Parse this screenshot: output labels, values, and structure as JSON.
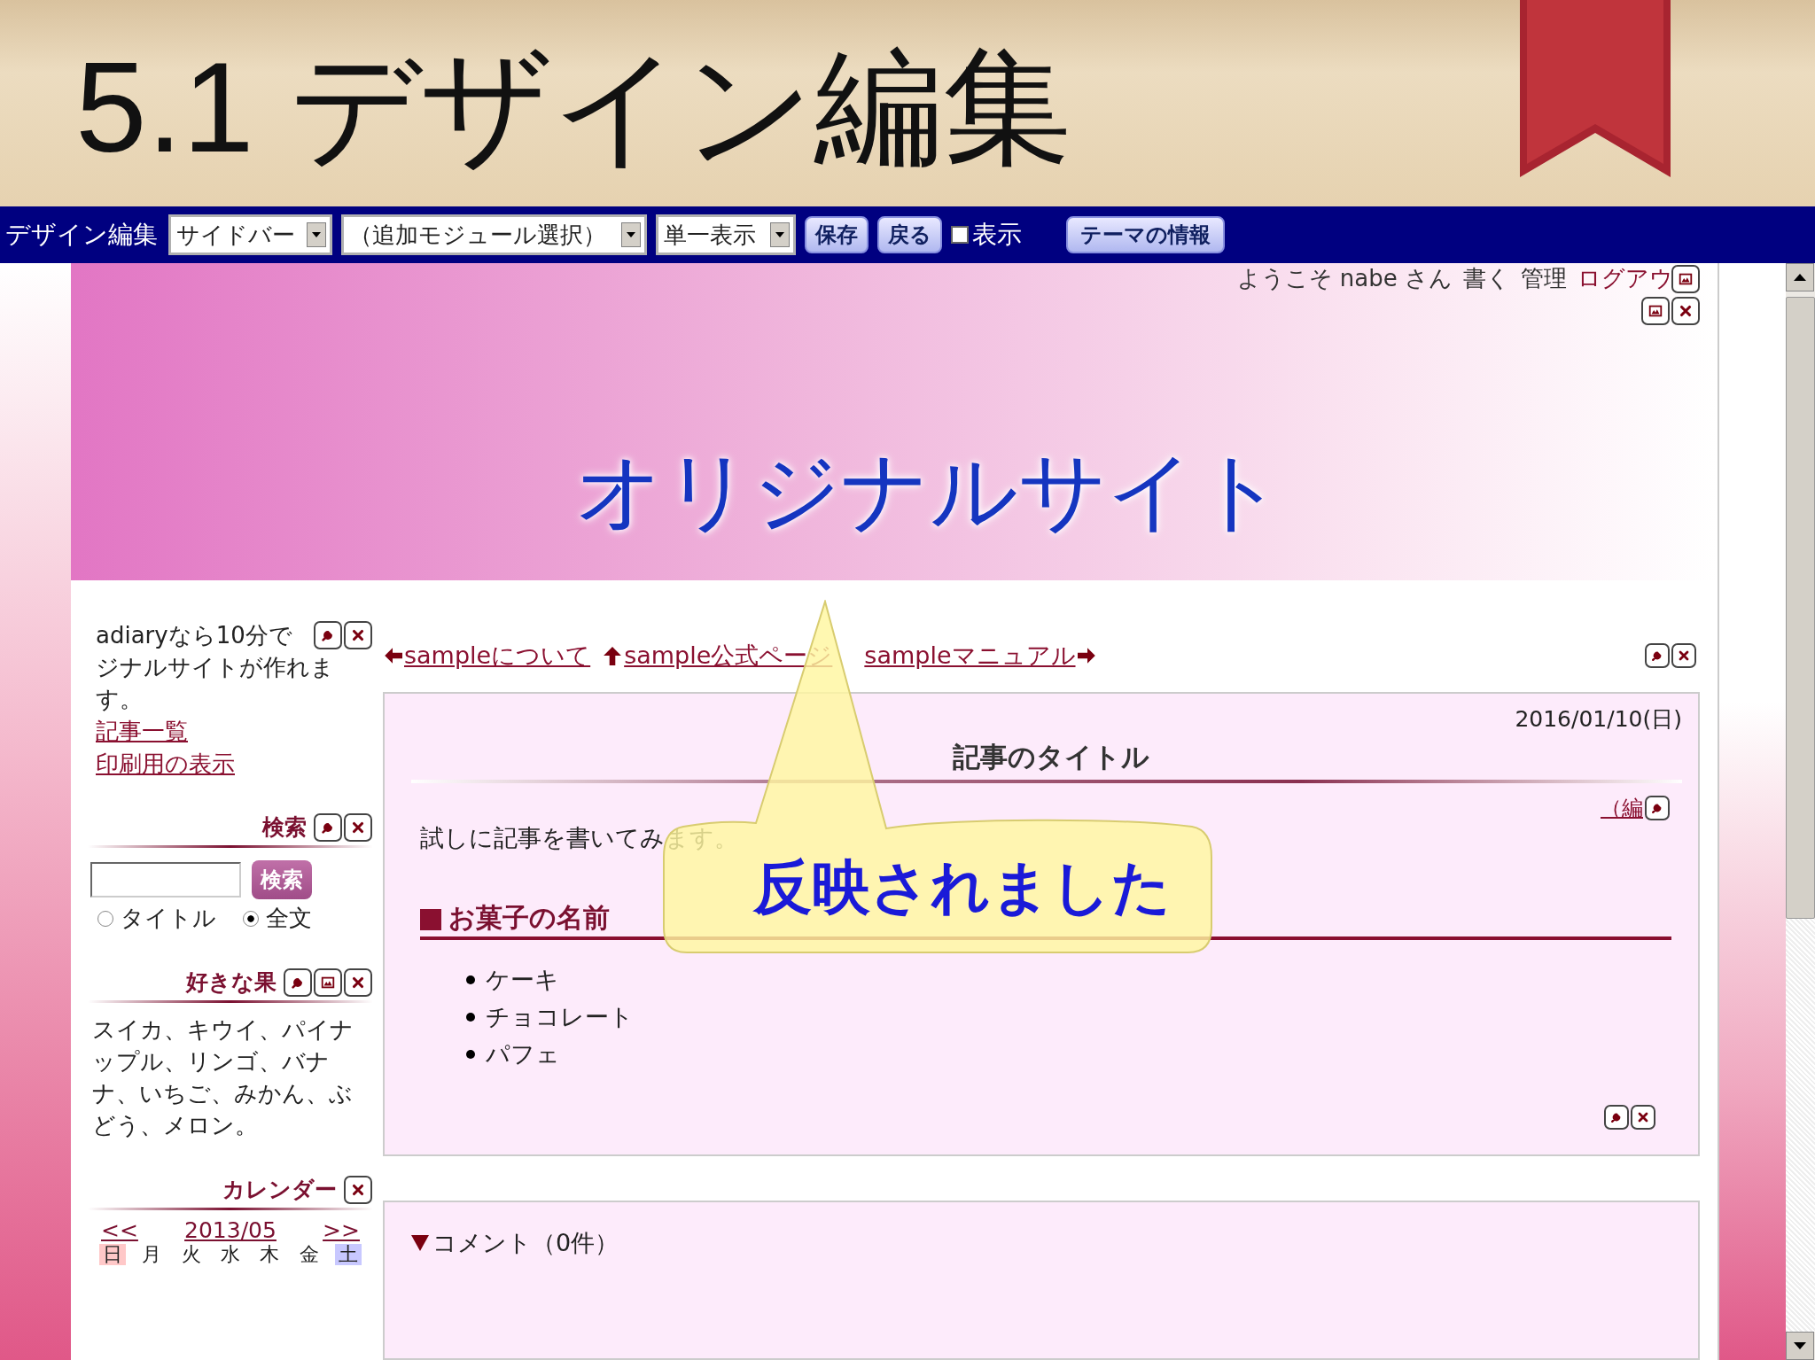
{
  "slide": {
    "title": "5.1 デザイン編集"
  },
  "toolbar": {
    "label": "デザイン編集",
    "selects": [
      {
        "value": "サイドバー"
      },
      {
        "value": "（追加モジュール選択）"
      },
      {
        "value": "単一表示"
      }
    ],
    "buttons": [
      "保存",
      "戻る"
    ],
    "checkbox": {
      "label": "表示",
      "checked": false
    },
    "theme_button": "テーマの情報"
  },
  "site": {
    "user_bar": [
      {
        "text": "ようこそ nabe さん",
        "kind": "text"
      },
      {
        "text": "書く",
        "kind": "text"
      },
      {
        "text": "管理",
        "kind": "text"
      },
      {
        "text": "ログアウ",
        "kind": "link"
      }
    ],
    "title": "オリジナルサイト"
  },
  "sidebar": {
    "intro": [
      "adiaryなら10分で",
      "ジナルサイトが作れます。"
    ],
    "links": [
      "記事一覧",
      "印刷用の表示"
    ],
    "search": {
      "heading": "検索",
      "button": "検索",
      "options": [
        {
          "label": "タイトル",
          "selected": false
        },
        {
          "label": "全文",
          "selected": true
        }
      ]
    },
    "fruits": {
      "heading": "好きな果",
      "text": "スイカ、キウイ、パイナップル、リンゴ、バナナ、いちご、みかん、ぶどう、メロン。"
    },
    "calendar": {
      "heading": "カレンダー",
      "prev": "<<",
      "month": "2013/05",
      "next": ">>",
      "weekdays": [
        {
          "label": "日",
          "kind": "sunday"
        },
        {
          "label": "月",
          "kind": "weekday"
        },
        {
          "label": "火",
          "kind": "weekday"
        },
        {
          "label": "水",
          "kind": "weekday"
        },
        {
          "label": "木",
          "kind": "weekday"
        },
        {
          "label": "金",
          "kind": "weekday"
        },
        {
          "label": "土",
          "kind": "saturday"
        }
      ]
    }
  },
  "main": {
    "nav": [
      {
        "text": "sampleについて",
        "kind": "prev"
      },
      {
        "text": "sample公式ページ",
        "kind": "up"
      },
      {
        "text": "sampleマニュアル",
        "kind": "next"
      }
    ],
    "article": {
      "date": "2016/01/10(日)",
      "title": "記事のタイトル",
      "edit": "（編",
      "body": "試しに記事を書いてみます。",
      "section": "お菓子の名前",
      "items": [
        "ケーキ",
        "チョコレート",
        "パフェ"
      ]
    },
    "comments": {
      "heading": "コメント（0件）"
    }
  },
  "callout": {
    "text": "反映されました"
  }
}
